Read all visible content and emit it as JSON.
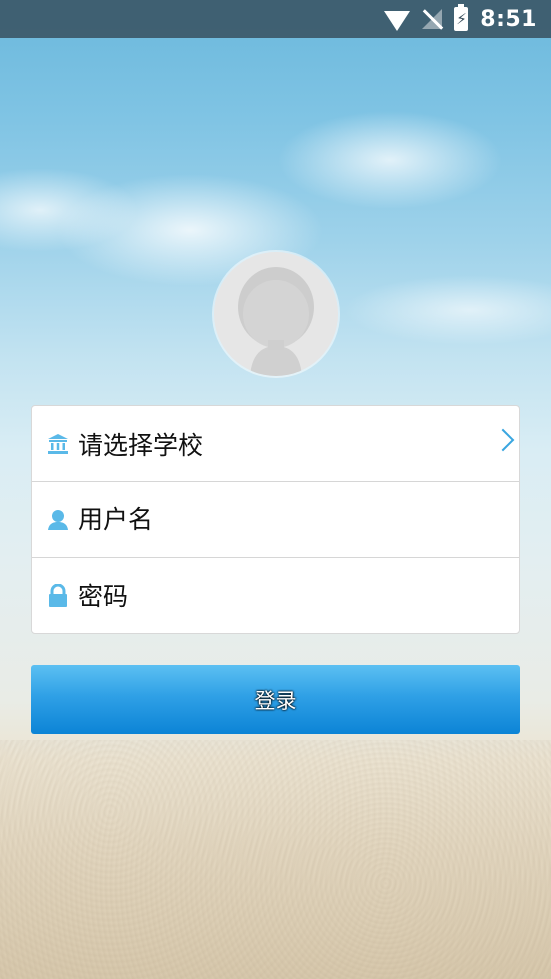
{
  "status_bar": {
    "time": "8:51",
    "icons": [
      "wifi-icon",
      "no-signal-icon",
      "battery-charging-icon"
    ]
  },
  "avatar": {
    "icon": "default-avatar-icon"
  },
  "form": {
    "school": {
      "label": "请选择学校",
      "icon": "school-building-icon",
      "arrow": "chevron-right-icon"
    },
    "username": {
      "placeholder": "用户名",
      "value": "",
      "icon": "user-icon"
    },
    "password": {
      "placeholder": "密码",
      "value": "",
      "icon": "lock-icon"
    }
  },
  "login_button": {
    "label": "登录"
  },
  "colors": {
    "accent": "#2fa0e6",
    "icon_blue": "#5ab9e8",
    "status_bar": "#37505f"
  }
}
